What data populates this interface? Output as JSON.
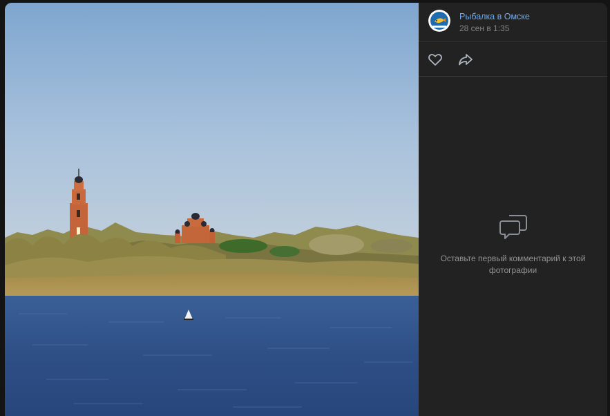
{
  "post": {
    "author": "Рыбалка в Омске",
    "date": "28 сен в 1:35"
  },
  "comments": {
    "empty_text": "Оставьте первый комментарий к этой фотографии"
  },
  "icons": {
    "like": "heart-outline-icon",
    "share": "share-arrow-icon",
    "comments_empty": "comment-bubbles-icon"
  },
  "colors": {
    "panel": "#222222",
    "author_link": "#71aaeb",
    "muted_text": "#828282"
  }
}
